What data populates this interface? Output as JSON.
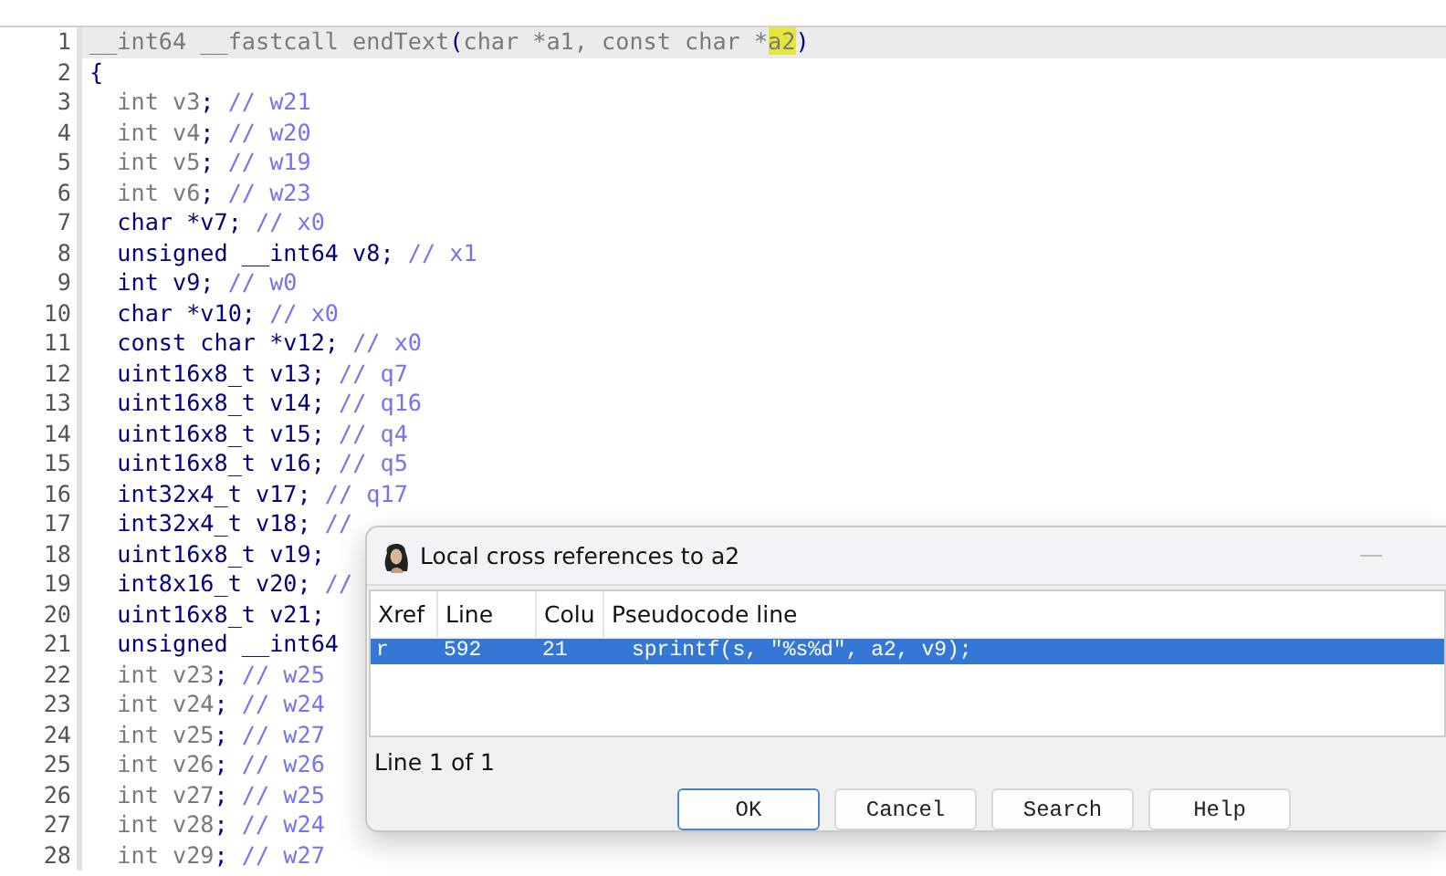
{
  "code_lines": [
    {
      "number": "1",
      "current": true,
      "segments": [
        {
          "text": "__int64 __fastcall endText",
          "kind": "dim"
        },
        {
          "text": "(",
          "kind": "punct"
        },
        {
          "text": "char *a1, const char *",
          "kind": "dim"
        },
        {
          "text": "a2",
          "kind": "highlight"
        },
        {
          "text": ")",
          "kind": "punct"
        }
      ]
    },
    {
      "number": "2",
      "current": false,
      "segments": [
        {
          "text": "{",
          "kind": "punct"
        }
      ]
    },
    {
      "number": "3",
      "current": false,
      "segments": [
        {
          "text": "  int v3",
          "kind": "dim"
        },
        {
          "text": ";",
          "kind": "punct"
        },
        {
          "text": " // w21",
          "kind": "comment"
        }
      ]
    },
    {
      "number": "4",
      "current": false,
      "segments": [
        {
          "text": "  int v4",
          "kind": "dim"
        },
        {
          "text": ";",
          "kind": "punct"
        },
        {
          "text": " // w20",
          "kind": "comment"
        }
      ]
    },
    {
      "number": "5",
      "current": false,
      "segments": [
        {
          "text": "  int v5",
          "kind": "dim"
        },
        {
          "text": ";",
          "kind": "punct"
        },
        {
          "text": " // w19",
          "kind": "comment"
        }
      ]
    },
    {
      "number": "6",
      "current": false,
      "segments": [
        {
          "text": "  int v6",
          "kind": "dim"
        },
        {
          "text": ";",
          "kind": "punct"
        },
        {
          "text": " // w23",
          "kind": "comment"
        }
      ]
    },
    {
      "number": "7",
      "current": false,
      "segments": [
        {
          "text": "  char *v7;",
          "kind": "type"
        },
        {
          "text": " // x0",
          "kind": "comment"
        }
      ]
    },
    {
      "number": "8",
      "current": false,
      "segments": [
        {
          "text": "  unsigned __int64 v8;",
          "kind": "type"
        },
        {
          "text": " // x1",
          "kind": "comment"
        }
      ]
    },
    {
      "number": "9",
      "current": false,
      "segments": [
        {
          "text": "  int v9;",
          "kind": "type"
        },
        {
          "text": " // w0",
          "kind": "comment"
        }
      ]
    },
    {
      "number": "10",
      "current": false,
      "segments": [
        {
          "text": "  char *v10;",
          "kind": "type"
        },
        {
          "text": " // x0",
          "kind": "comment"
        }
      ]
    },
    {
      "number": "11",
      "current": false,
      "segments": [
        {
          "text": "  const char *v12;",
          "kind": "type"
        },
        {
          "text": " // x0",
          "kind": "comment"
        }
      ]
    },
    {
      "number": "12",
      "current": false,
      "segments": [
        {
          "text": "  uint16x8_t v13;",
          "kind": "type"
        },
        {
          "text": " // q7",
          "kind": "comment"
        }
      ]
    },
    {
      "number": "13",
      "current": false,
      "segments": [
        {
          "text": "  uint16x8_t v14;",
          "kind": "type"
        },
        {
          "text": " // q16",
          "kind": "comment"
        }
      ]
    },
    {
      "number": "14",
      "current": false,
      "segments": [
        {
          "text": "  uint16x8_t v15;",
          "kind": "type"
        },
        {
          "text": " // q4",
          "kind": "comment"
        }
      ]
    },
    {
      "number": "15",
      "current": false,
      "segments": [
        {
          "text": "  uint16x8_t v16;",
          "kind": "type"
        },
        {
          "text": " // q5",
          "kind": "comment"
        }
      ]
    },
    {
      "number": "16",
      "current": false,
      "segments": [
        {
          "text": "  int32x4_t v17;",
          "kind": "type"
        },
        {
          "text": " // q17",
          "kind": "comment"
        }
      ]
    },
    {
      "number": "17",
      "current": false,
      "segments": [
        {
          "text": "  int32x4_t v18;",
          "kind": "type"
        },
        {
          "text": " //",
          "kind": "comment"
        }
      ]
    },
    {
      "number": "18",
      "current": false,
      "segments": [
        {
          "text": "  uint16x8_t v19;",
          "kind": "type"
        }
      ]
    },
    {
      "number": "19",
      "current": false,
      "segments": [
        {
          "text": "  int8x16_t v20;",
          "kind": "type"
        },
        {
          "text": " //",
          "kind": "comment"
        }
      ]
    },
    {
      "number": "20",
      "current": false,
      "segments": [
        {
          "text": "  uint16x8_t v21;",
          "kind": "type"
        }
      ]
    },
    {
      "number": "21",
      "current": false,
      "segments": [
        {
          "text": "  unsigned __int64",
          "kind": "type"
        }
      ]
    },
    {
      "number": "22",
      "current": false,
      "segments": [
        {
          "text": "  int v23",
          "kind": "dim"
        },
        {
          "text": ";",
          "kind": "punct"
        },
        {
          "text": " // w25",
          "kind": "comment"
        }
      ]
    },
    {
      "number": "23",
      "current": false,
      "segments": [
        {
          "text": "  int v24",
          "kind": "dim"
        },
        {
          "text": ";",
          "kind": "punct"
        },
        {
          "text": " // w24",
          "kind": "comment"
        }
      ]
    },
    {
      "number": "24",
      "current": false,
      "segments": [
        {
          "text": "  int v25",
          "kind": "dim"
        },
        {
          "text": ";",
          "kind": "punct"
        },
        {
          "text": " // w27",
          "kind": "comment"
        }
      ]
    },
    {
      "number": "25",
      "current": false,
      "segments": [
        {
          "text": "  int v26",
          "kind": "dim"
        },
        {
          "text": ";",
          "kind": "punct"
        },
        {
          "text": " // w26",
          "kind": "comment"
        }
      ]
    },
    {
      "number": "26",
      "current": false,
      "segments": [
        {
          "text": "  int v27",
          "kind": "dim"
        },
        {
          "text": ";",
          "kind": "punct"
        },
        {
          "text": " // w25",
          "kind": "comment"
        }
      ]
    },
    {
      "number": "27",
      "current": false,
      "segments": [
        {
          "text": "  int v28",
          "kind": "dim"
        },
        {
          "text": ";",
          "kind": "punct"
        },
        {
          "text": " // w24",
          "kind": "comment"
        }
      ]
    },
    {
      "number": "28",
      "current": false,
      "segments": [
        {
          "text": "  int v29",
          "kind": "dim"
        },
        {
          "text": ";",
          "kind": "punct"
        },
        {
          "text": " // w27",
          "kind": "comment"
        }
      ]
    }
  ],
  "dialog": {
    "title": "Local cross references to a2",
    "columns": [
      "Xref",
      "Line",
      "Colu",
      "Pseudocode line"
    ],
    "rows": [
      {
        "cells": [
          "r",
          "592",
          "21",
          "sprintf(s, \"%s%d\", a2, v9);"
        ],
        "selected": true
      }
    ],
    "status": "Line 1 of 1",
    "buttons": [
      {
        "label": "OK",
        "focused": true
      },
      {
        "label": "Cancel",
        "focused": false
      },
      {
        "label": "Search",
        "focused": false
      },
      {
        "label": "Help",
        "focused": false
      }
    ]
  }
}
